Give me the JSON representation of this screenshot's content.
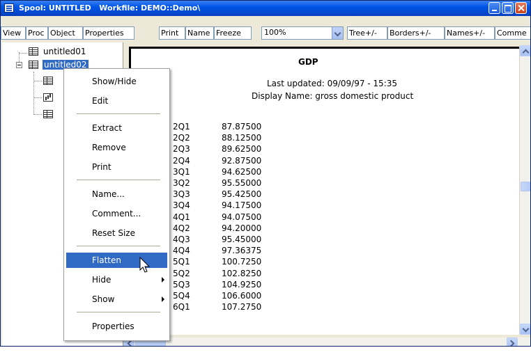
{
  "window": {
    "title": "Spool: UNTITLED   Workfile: DEMO::Demo\\",
    "icon": "spool-icon"
  },
  "toolbar": {
    "buttons": [
      "View",
      "Proc",
      "Object",
      "Properties",
      "Print",
      "Name",
      "Freeze"
    ],
    "zoom": "100%",
    "toggles": [
      "Tree+/-",
      "Borders+/-",
      "Names+/-",
      "Comme"
    ]
  },
  "tree": {
    "item1": "untitled01",
    "item2": "untitled02"
  },
  "document": {
    "title": "GDP",
    "last_updated": "Last updated: 09/09/97 - 15:35",
    "display_name": "Display Name: gross domestic product",
    "observations": [
      "2Q1",
      "2Q2",
      "2Q3",
      "2Q4",
      "3Q1",
      "3Q2",
      "3Q3",
      "3Q4",
      "4Q1",
      "4Q2",
      "4Q3",
      "4Q4",
      "5Q1",
      "5Q2",
      "5Q3",
      "5Q4",
      "6Q1"
    ],
    "values": [
      "87.87500",
      "88.12500",
      "89.62500",
      "92.87500",
      "94.62500",
      "95.55000",
      "95.42500",
      "94.17500",
      "94.07500",
      "94.20000",
      "95.45000",
      "97.36375",
      "100.7250",
      "102.8250",
      "104.9250",
      "106.6000",
      "107.2750"
    ]
  },
  "context_menu": {
    "items": [
      {
        "label": "Show/Hide"
      },
      {
        "label": "Edit"
      },
      {
        "label": "Extract"
      },
      {
        "label": "Remove"
      },
      {
        "label": "Print"
      },
      {
        "label": "Name..."
      },
      {
        "label": "Comment..."
      },
      {
        "label": "Reset Size"
      },
      {
        "label": "Flatten",
        "highlighted": true
      },
      {
        "label": "Hide",
        "submenu": true
      },
      {
        "label": "Show",
        "submenu": true
      },
      {
        "label": "Properties"
      }
    ]
  },
  "colors": {
    "title_bar": "#0055e5",
    "selection": "#316ac5"
  }
}
